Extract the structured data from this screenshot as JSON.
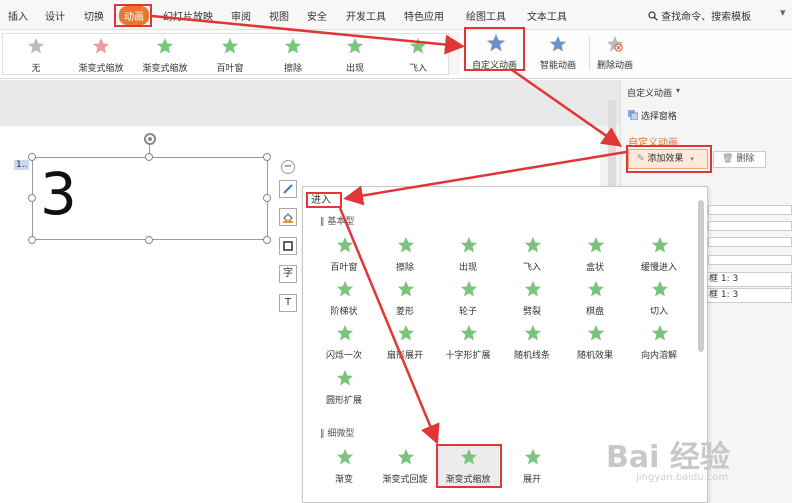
{
  "menu": {
    "items": [
      "插入",
      "设计",
      "切换",
      "动画",
      "幻灯片放映",
      "审阅",
      "视图",
      "安全",
      "开发工具",
      "特色应用",
      "绘图工具",
      "文本工具"
    ],
    "active": "动画",
    "search": "查找命令、搜索模板"
  },
  "ribbon": {
    "gallery": [
      "无",
      "渐变式缩放",
      "渐变式缩放",
      "百叶窗",
      "擦除",
      "出现",
      "飞入"
    ],
    "custom_animation": "自定义动画",
    "smart_animation": "智能动画",
    "delete_animation": "删除动画"
  },
  "slide": {
    "number_badge": "1..",
    "text": "3"
  },
  "float_tools": {
    "text_char": "字",
    "text_box": "T"
  },
  "panel": {
    "title": "自定义动画",
    "select_pane": "选择窗格",
    "section": "自定义动画",
    "add_effect": "添加效果",
    "delete": "删除",
    "row1": "框 1: 3",
    "row2": "框 1: 3"
  },
  "dropdown": {
    "header": "进入",
    "basic_label": "基本型",
    "basic": [
      "百叶窗",
      "擦除",
      "出现",
      "飞入",
      "盒状",
      "缓慢进入",
      "阶梯状",
      "菱形",
      "轮子",
      "劈裂",
      "棋盘",
      "切入",
      "闪烁一次",
      "扇形展开",
      "十字形扩展",
      "随机线条",
      "随机效果",
      "向内溶解",
      "圆形扩展"
    ],
    "subtle_label": "细微型",
    "subtle": [
      "渐变",
      "渐变式回旋",
      "渐变式缩放",
      "展开"
    ]
  },
  "watermark": {
    "logo": "Bai 经验",
    "url": "jingyan.baidu.com"
  },
  "colors": {
    "accent": "#e9772f",
    "highlight": "#e23535",
    "star": "#7cc47a"
  }
}
